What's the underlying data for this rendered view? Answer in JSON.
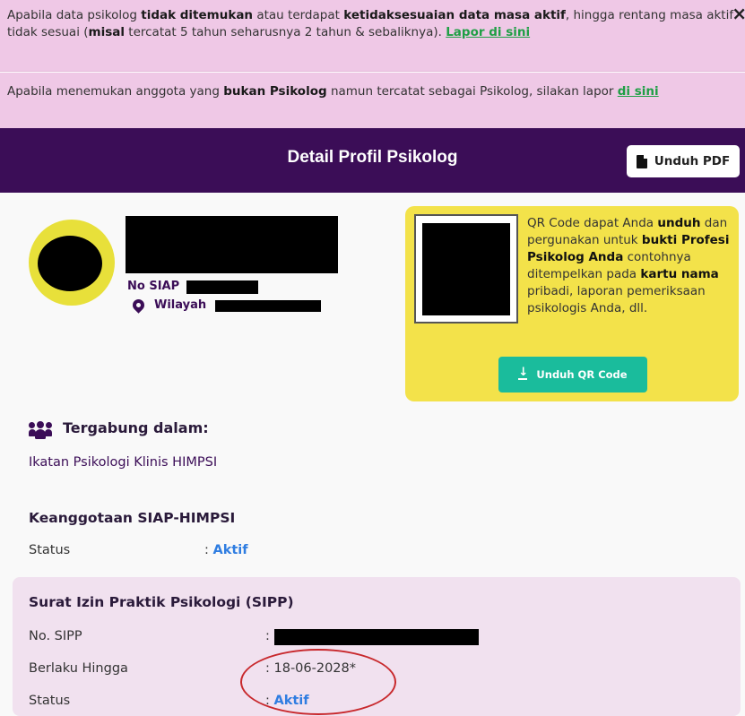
{
  "notices": {
    "n1": {
      "t1": "Apabila data psikolog ",
      "b1": "tidak ditemukan",
      "t2": " atau terdapat ",
      "b2": "ketidaksesuaian data masa aktif",
      "t3": ", hingga rentang masa aktif tidak sesuai (",
      "b3": "misal",
      "t4": " tercatat 5 tahun seharusnya 2 tahun & sebaliknya). ",
      "link": "Lapor di sini"
    },
    "n2": {
      "t1": "Apabila menemukan anggota yang ",
      "b1": "bukan Psikolog",
      "t2": " namun tercatat sebagai Psikolog, silakan lapor ",
      "link": "di sini"
    },
    "close_glyph": "×"
  },
  "header": {
    "title": "Detail Profil Psikolog",
    "pdf_button": "Unduh PDF"
  },
  "profile": {
    "siap_label": "No SIAP",
    "wilayah_label": "Wilayah"
  },
  "qr": {
    "t1": "QR Code dapat Anda ",
    "b1": "unduh",
    "t2": " dan pergunakan untuk ",
    "b2": "bukti Profesi Psikolog Anda",
    "t3": " contohnya ditempelkan pada ",
    "b3": "kartu nama",
    "t4": " pribadi, laporan pemeriksaan psikologis Anda, dll.",
    "button": "Unduh QR Code"
  },
  "joined": {
    "title": "Tergabung dalam:",
    "org": "Ikatan Psikologi Klinis HIMPSI"
  },
  "membership": {
    "title": "Keanggotaan SIAP-HIMPSI",
    "status_label": "Status",
    "colon": ":",
    "status_value": "Aktif"
  },
  "sipp": {
    "title": "Surat Izin Praktik Psikologi (SIPP)",
    "no_label": "No. SIPP",
    "colon": ":",
    "valid_label": "Berlaku Hingga",
    "valid_value": ": 18-06-2028*",
    "status_label": "Status",
    "status_value": "Aktif"
  },
  "colors": {
    "notice_bg": "#efc8e6",
    "header_bg": "#3b0d57",
    "link_green": "#1f9f45",
    "qr_card_bg": "#f3e24a",
    "teal_button": "#1abc9c",
    "status_blue": "#2f7de1",
    "annotation_red": "#c8282c"
  },
  "icons": [
    "close-icon",
    "file-pdf-icon",
    "map-pin-icon",
    "download-icon",
    "users-icon"
  ]
}
